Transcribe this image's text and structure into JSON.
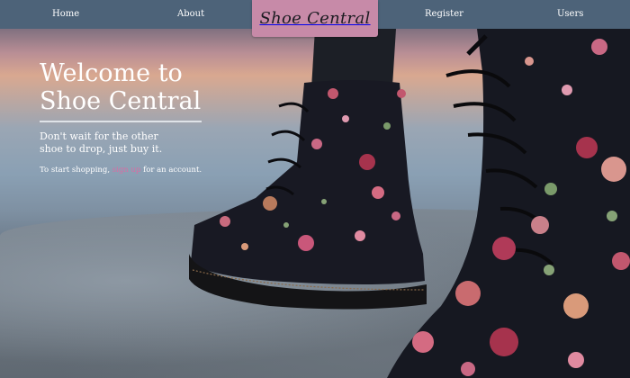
{
  "nav": {
    "home_label": "Home",
    "about_label": "About",
    "register_label": "Register",
    "users_label": "Users",
    "brand": "Shoe Central"
  },
  "hero": {
    "title": "Welcome to Shoe Central",
    "tagline": "Don't wait for the other shoe to drop, just buy it.",
    "cta_prefix": "To start shopping,",
    "cta_link": "sign up",
    "cta_suffix": "for an account."
  },
  "colors": {
    "nav_background": "#4d6379",
    "brand_background": "#c78aa8",
    "link_accent": "#d96da3"
  }
}
